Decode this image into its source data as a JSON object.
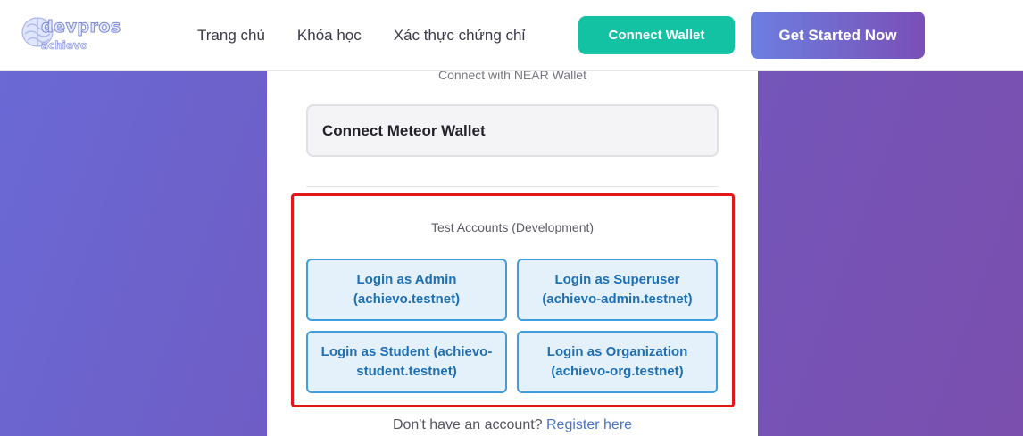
{
  "header": {
    "logo": {
      "top_text": "devpros",
      "bottom_text": "achievo"
    },
    "nav": [
      {
        "label": "Trang chủ"
      },
      {
        "label": "Khóa học"
      },
      {
        "label": "Xác thực chứng chỉ"
      }
    ],
    "connect_wallet_label": "Connect Wallet",
    "get_started_label": "Get Started Now"
  },
  "card": {
    "connect_with_label": "Connect with NEAR Wallet",
    "meteor_wallet_label": "Connect Meteor Wallet",
    "test_accounts": {
      "title": "Test Accounts (Development)",
      "buttons": [
        {
          "label": "Login as Admin (achievo.testnet)"
        },
        {
          "label": "Login as Superuser (achievo-admin.testnet)"
        },
        {
          "label": "Login as Student (achievo-student.testnet)"
        },
        {
          "label": "Login as Organization (achievo-org.testnet)"
        }
      ]
    },
    "register_prompt": "Don't have an account?",
    "register_link": "Register here"
  },
  "colors": {
    "accent_teal": "#13c2a2",
    "accent_purple": "#7059c0",
    "highlight_red": "#e01818",
    "test_button_blue": "#3f9ee0"
  }
}
